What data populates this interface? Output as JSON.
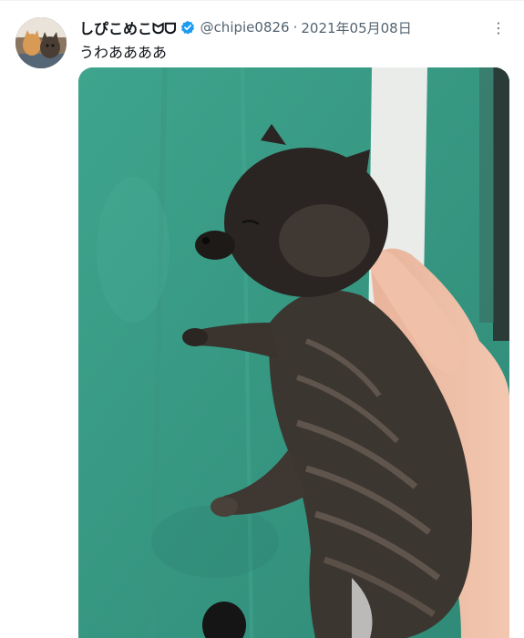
{
  "tweet": {
    "display_name": "しぴこめこᗢᗜ",
    "handle": "@chipie0826",
    "separator": "·",
    "date": "2021年05月08日",
    "text": "うわああああ",
    "more_icon": "⋮",
    "verified_color": "#1d9bf0",
    "icons": [
      "avatar",
      "verified-badge-icon",
      "more-options-icon"
    ]
  }
}
